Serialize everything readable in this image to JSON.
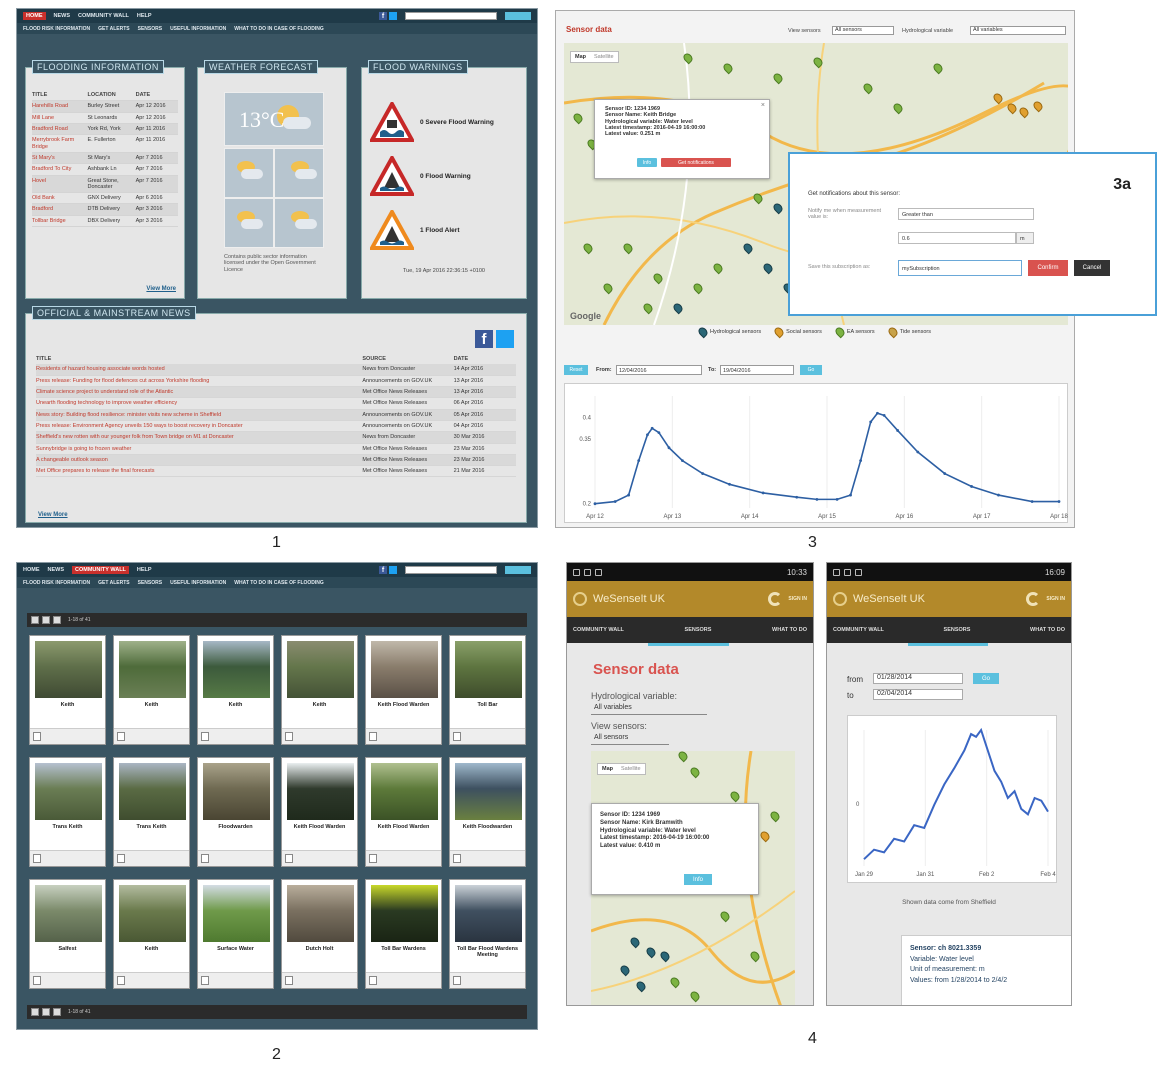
{
  "figure_labels": {
    "p1": "1",
    "p2": "2",
    "p3": "3",
    "p4": "4",
    "p3a": "3a"
  },
  "p1": {
    "topnav": [
      "HOME",
      "NEWS",
      "COMMUNITY WALL",
      "HELP"
    ],
    "subnav": [
      "FLOOD RISK INFORMATION",
      "GET ALERTS",
      "SENSORS",
      "USEFUL INFORMATION",
      "WHAT TO DO IN CASE OF FLOODING"
    ],
    "flood_box": {
      "title": "FLOODING INFORMATION",
      "headers": [
        "TITLE",
        "LOCATION",
        "DATE"
      ],
      "rows": [
        [
          "Harehills Road",
          "Burley Street",
          "Apr 12 2016"
        ],
        [
          "Mill Lane",
          "St Leonards",
          "Apr 12 2016"
        ],
        [
          "Bradford Road",
          "York Rd, York",
          "Apr 11 2016"
        ],
        [
          "Merrybrook Farm Bridge",
          "E. Fullerton",
          "Apr 11 2016"
        ],
        [
          "St Mary's",
          "St Mary's",
          "Apr 7 2016"
        ],
        [
          "Bradford To City",
          "Ashbank Ln",
          "Apr 7 2016"
        ],
        [
          "Hovel",
          "Great Stone, Doncaster",
          "Apr 7 2016"
        ],
        [
          "Old Bank",
          "GNX Delivery",
          "Apr 6 2016"
        ],
        [
          "Bradford",
          "DTB Delivery",
          "Apr 3 2016"
        ],
        [
          "Tollbar Bridge",
          "DBX Delivery",
          "Apr 3 2016"
        ]
      ],
      "view_more": "View More"
    },
    "weather_box": {
      "title": "WEATHER FORECAST",
      "temp": "13°C",
      "caption": "Contains public sector information licensed under the Open Government Licence"
    },
    "warnings_box": {
      "title": "FLOOD WARNINGS",
      "items": [
        "0 Severe Flood Warning",
        "0 Flood Warning",
        "1 Flood Alert"
      ],
      "timestamp": "Tue, 19 Apr 2016 22:36:15 +0100"
    },
    "news_box": {
      "title": "OFFICIAL & MAINSTREAM NEWS",
      "headers": [
        "TITLE",
        "SOURCE",
        "DATE"
      ],
      "rows": [
        [
          "Residents of hazard housing associate words hosted",
          "News from Doncaster",
          "14 Apr 2016"
        ],
        [
          "Press release: Funding for flood defences cut across Yorkshire flooding",
          "Announcements on GOV.UK",
          "13 Apr 2016"
        ],
        [
          "Climate science project to understand role of the Atlantic",
          "Met Office News Releases",
          "13 Apr 2016"
        ],
        [
          "Unearth flooding technology to improve weather efficiency",
          "Met Office News Releases",
          "06 Apr 2016"
        ],
        [
          "News story: Building flood resilience: minister visits new scheme in Sheffield",
          "Announcements on GOV.UK",
          "05 Apr 2016"
        ],
        [
          "Press release: Environment Agency unveils 150 ways to boost recovery in Doncaster",
          "Announcements on GOV.UK",
          "04 Apr 2016"
        ],
        [
          "Sheffield's new rotten with our younger folk from Town bridge on M1 at Doncaster",
          "News from Doncaster",
          "30 Mar 2016"
        ],
        [
          "Sunnybridge is going to frozen weather",
          "Met Office News Releases",
          "23 Mar 2016"
        ],
        [
          "A changeable outlook season",
          "Met Office News Releases",
          "23 Mar 2016"
        ],
        [
          "Met Office prepares to release the final forecasts",
          "Met Office News Releases",
          "21 Mar 2016"
        ]
      ],
      "view_more": "View More"
    }
  },
  "p2": {
    "topnav": [
      "HOME",
      "NEWS",
      "COMMUNITY WALL",
      "HELP"
    ],
    "subnav": [
      "FLOOD RISK INFORMATION",
      "GET ALERTS",
      "SENSORS",
      "USEFUL INFORMATION",
      "WHAT TO DO IN CASE OF FLOODING"
    ],
    "pager_text": "1-18 of 41",
    "cards": [
      {
        "caption": "Keith",
        "colors": [
          "#5f6f4a",
          "#8c9a6e",
          "#3f4a33"
        ]
      },
      {
        "caption": "Keith",
        "colors": [
          "#4e6b3a",
          "#9fb18a",
          "#6a7f55"
        ]
      },
      {
        "caption": "Keith",
        "colors": [
          "#3c5a3c",
          "#a7b8c6",
          "#567a45"
        ]
      },
      {
        "caption": "Keith",
        "colors": [
          "#64764b",
          "#8a8c70",
          "#445236"
        ]
      },
      {
        "caption": "Keith Flood Warden",
        "colors": [
          "#8a7d6c",
          "#c0b8aa",
          "#5a5046"
        ]
      },
      {
        "caption": "Toll Bar",
        "colors": [
          "#5e7540",
          "#8aa06a",
          "#3e4c2c"
        ]
      },
      {
        "caption": "Trans Keith",
        "colors": [
          "#6a7d54",
          "#b5c0d0",
          "#4a5a38"
        ]
      },
      {
        "caption": "Trans Keith",
        "colors": [
          "#5a6b44",
          "#aab5c4",
          "#3f4d2f"
        ]
      },
      {
        "caption": "Floodwarden",
        "colors": [
          "#6f6a52",
          "#a9a28a",
          "#4a4533"
        ]
      },
      {
        "caption": "Keith Flood Warden",
        "colors": [
          "#2f3a2c",
          "#e9eef0",
          "#1f2a1c"
        ]
      },
      {
        "caption": "Keith Flood Warden",
        "colors": [
          "#5d7a3a",
          "#b0c090",
          "#3b5226"
        ]
      },
      {
        "caption": "Keith Floodwarden",
        "colors": [
          "#3d5060",
          "#9fb8cc",
          "#6a8040"
        ]
      },
      {
        "caption": "Salfest",
        "colors": [
          "#7b8a6a",
          "#c7d0c0",
          "#55624a"
        ]
      },
      {
        "caption": "Keith",
        "colors": [
          "#6a7a4c",
          "#b3bca0",
          "#4a5834"
        ]
      },
      {
        "caption": "Surface Water",
        "colors": [
          "#6f9a4a",
          "#d4dce4",
          "#4f7a30"
        ]
      },
      {
        "caption": "Dutch Holt",
        "colors": [
          "#7a7060",
          "#b9ae9c",
          "#514a3e"
        ]
      },
      {
        "caption": "Toll Bar Wardens",
        "colors": [
          "#2a3a22",
          "#c8d82a",
          "#1a2414"
        ]
      },
      {
        "caption": "Toll Bar Flood Wardens Meeting",
        "colors": [
          "#405060",
          "#cbd2d8",
          "#2a3440"
        ]
      }
    ]
  },
  "p3": {
    "title": "Sensor data",
    "view_sensors_label": "View sensors",
    "view_sensors_value": "All sensors",
    "hydro_label": "Hydrological variable",
    "hydro_value": "All variables",
    "map_tabs": [
      "Map",
      "Satellite"
    ],
    "popup": {
      "lines": [
        "Sensor ID: 1234 1969",
        "Sensor Name: Keith Bridge",
        "Hydrological variable: Water level",
        "Latest timestamp: 2016-04-19 16:00:00",
        "Latest value: 0.251 m"
      ],
      "btn1": "Info",
      "btn2": "Get notifications"
    },
    "inset": {
      "title": "Get notifications about this sensor:",
      "notify_label": "Notify me when measurement value is:",
      "notify_value": "Greater than",
      "threshold": "0.6",
      "unit": "m",
      "save_label": "Save this subscription as:",
      "save_value": "mySubscription",
      "confirm": "Confirm",
      "cancel": "Cancel"
    },
    "legend": [
      "Hydrological sensors",
      "Social sensors",
      "EA sensors",
      "Tide sensors"
    ],
    "controls": {
      "from_label": "From:",
      "from_value": "12/04/2016",
      "to_label": "To:",
      "to_value": "19/04/2016",
      "btn_left": "Reset",
      "btn_go": "Go"
    },
    "google": "Google",
    "chart_data": {
      "type": "line",
      "title": "",
      "xlabel": "",
      "ylabel": "",
      "xticks": [
        "Apr 12",
        "Apr 13",
        "Apr 14",
        "Apr 15",
        "Apr 16",
        "Apr 17",
        "Apr 18"
      ],
      "yticks": [
        "0.2",
        "0.35",
        "0.4"
      ],
      "ylim": [
        0.19,
        0.45
      ],
      "series": [
        {
          "values": [
            {
              "x": 0.0,
              "y": 0.2
            },
            {
              "x": 0.3,
              "y": 0.205
            },
            {
              "x": 0.5,
              "y": 0.22
            },
            {
              "x": 0.65,
              "y": 0.3
            },
            {
              "x": 0.78,
              "y": 0.36
            },
            {
              "x": 0.85,
              "y": 0.375
            },
            {
              "x": 0.95,
              "y": 0.365
            },
            {
              "x": 1.1,
              "y": 0.33
            },
            {
              "x": 1.3,
              "y": 0.3
            },
            {
              "x": 1.6,
              "y": 0.27
            },
            {
              "x": 2.0,
              "y": 0.245
            },
            {
              "x": 2.5,
              "y": 0.225
            },
            {
              "x": 3.0,
              "y": 0.215
            },
            {
              "x": 3.3,
              "y": 0.21
            },
            {
              "x": 3.6,
              "y": 0.21
            },
            {
              "x": 3.8,
              "y": 0.22
            },
            {
              "x": 3.95,
              "y": 0.3
            },
            {
              "x": 4.1,
              "y": 0.39
            },
            {
              "x": 4.2,
              "y": 0.41
            },
            {
              "x": 4.3,
              "y": 0.405
            },
            {
              "x": 4.5,
              "y": 0.37
            },
            {
              "x": 4.8,
              "y": 0.32
            },
            {
              "x": 5.2,
              "y": 0.27
            },
            {
              "x": 5.6,
              "y": 0.24
            },
            {
              "x": 6.0,
              "y": 0.22
            },
            {
              "x": 6.5,
              "y": 0.205
            },
            {
              "x": 6.9,
              "y": 0.205
            }
          ]
        }
      ]
    }
  },
  "p4": {
    "phone1": {
      "time": "10:33",
      "app_title": "WeSenseIt UK",
      "sign_in": "SIGN IN",
      "tabs": [
        "COMMUNITY WALL",
        "SENSORS",
        "WHAT TO DO"
      ],
      "heading": "Sensor data",
      "hydro_label": "Hydrological variable:",
      "hydro_value": "All variables",
      "view_label": "View sensors:",
      "view_value": "All sensors",
      "map_tabs": [
        "Map",
        "Satellite"
      ],
      "popup": [
        "Sensor ID: 1234 1969",
        "Sensor Name: Kirk Bramwith",
        "Hydrological variable: Water level",
        "Latest timestamp: 2016-04-19 16:00:00",
        "Latest value: 0.410 m"
      ],
      "popup_btn": "Info"
    },
    "phone2": {
      "time": "16:09",
      "app_title": "WeSenseIt UK",
      "sign_in": "SIGN IN",
      "tabs": [
        "COMMUNITY WALL",
        "SENSORS",
        "WHAT TO DO"
      ],
      "from_label": "from",
      "from_value": "01/28/2014",
      "to_label": "to",
      "to_value": "02/04/2014",
      "go": "Go",
      "source_note": "Shown data come from Sheffield",
      "info": [
        "Sensor: ch 8021.3359",
        "Variable: Water level",
        "Unit of measurement: m",
        "Values: from 1/28/2014 to 2/4/2"
      ],
      "chart_data": {
        "type": "line",
        "xticks": [
          "Jan 29",
          "Jan 31",
          "Feb 2",
          "Feb 4"
        ],
        "yticks": [
          "0"
        ],
        "series": [
          {
            "values": [
              {
                "x": 0,
                "y": 0.05
              },
              {
                "x": 0.3,
                "y": 0.12
              },
              {
                "x": 0.6,
                "y": 0.1
              },
              {
                "x": 0.9,
                "y": 0.2
              },
              {
                "x": 1.2,
                "y": 0.18
              },
              {
                "x": 1.5,
                "y": 0.3
              },
              {
                "x": 1.8,
                "y": 0.28
              },
              {
                "x": 2.1,
                "y": 0.45
              },
              {
                "x": 2.4,
                "y": 0.6
              },
              {
                "x": 2.7,
                "y": 0.72
              },
              {
                "x": 3.0,
                "y": 0.85
              },
              {
                "x": 3.2,
                "y": 0.97
              },
              {
                "x": 3.35,
                "y": 0.95
              },
              {
                "x": 3.5,
                "y": 1.0
              },
              {
                "x": 3.7,
                "y": 0.85
              },
              {
                "x": 3.9,
                "y": 0.7
              },
              {
                "x": 4.1,
                "y": 0.62
              },
              {
                "x": 4.3,
                "y": 0.5
              },
              {
                "x": 4.5,
                "y": 0.55
              },
              {
                "x": 4.7,
                "y": 0.42
              },
              {
                "x": 4.9,
                "y": 0.38
              },
              {
                "x": 5.1,
                "y": 0.5
              },
              {
                "x": 5.3,
                "y": 0.48
              },
              {
                "x": 5.5,
                "y": 0.4
              }
            ]
          }
        ]
      }
    }
  }
}
